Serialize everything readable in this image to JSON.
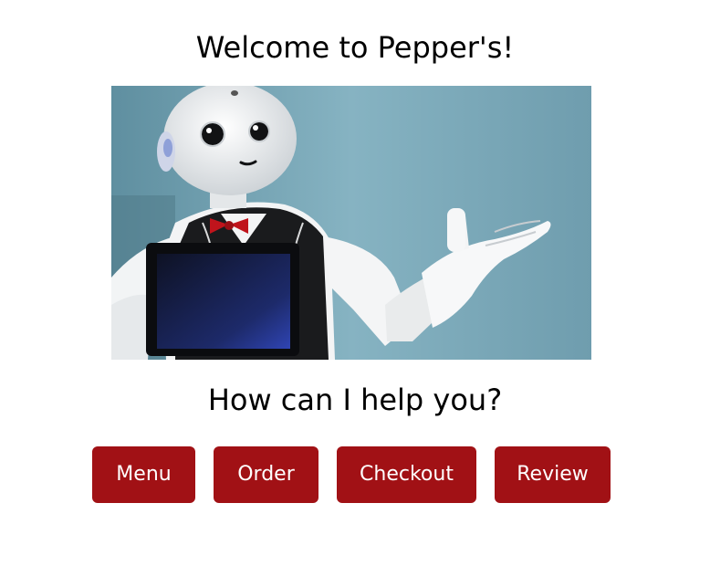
{
  "header": {
    "title": "Welcome to Pepper's!"
  },
  "hero_image": {
    "subject": "pepper-robot"
  },
  "prompt": {
    "text": "How can I help you?"
  },
  "actions": {
    "menu_label": "Menu",
    "order_label": "Order",
    "checkout_label": "Checkout",
    "review_label": "Review"
  },
  "colors": {
    "button_background": "#a11115",
    "button_text": "#ffffff",
    "page_background": "#ffffff"
  }
}
